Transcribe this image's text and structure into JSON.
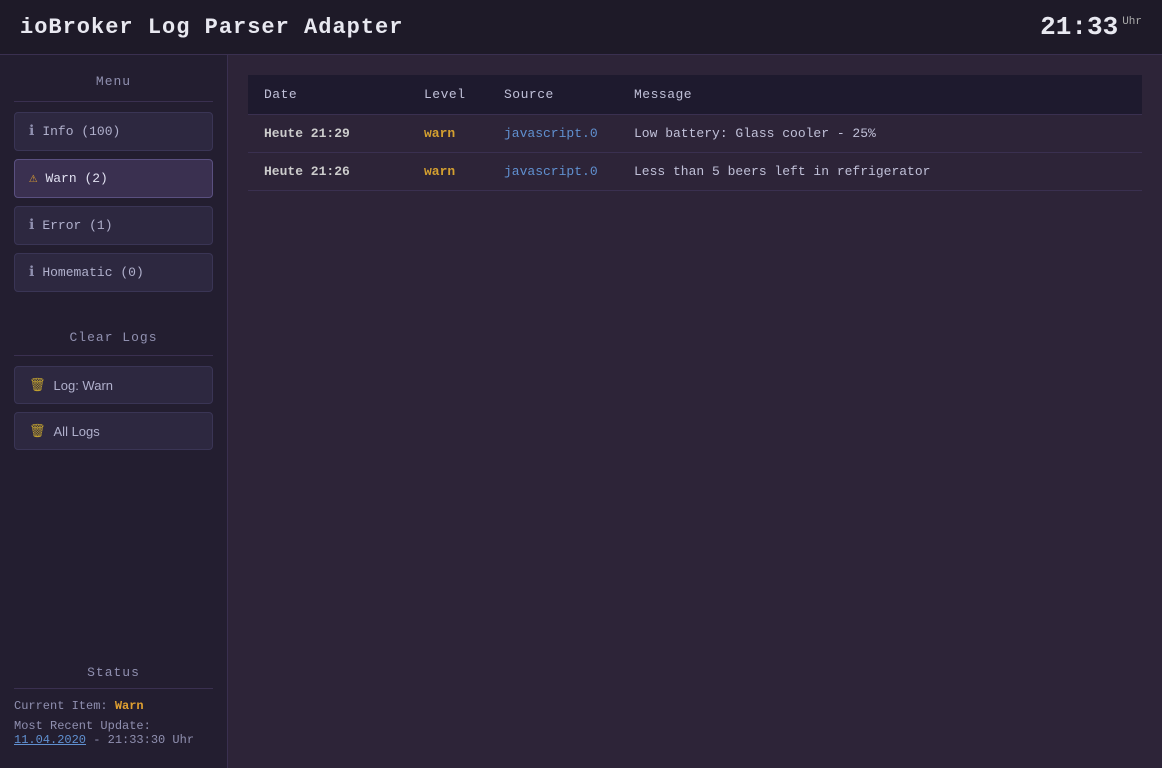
{
  "header": {
    "title": "ioBroker Log Parser Adapter",
    "time": "21:33",
    "time_unit": "Uhr"
  },
  "sidebar": {
    "menu_title": "Menu",
    "items": [
      {
        "id": "info",
        "icon": "ℹ",
        "icon_type": "info",
        "label": "Info (100)",
        "active": false
      },
      {
        "id": "warn",
        "icon": "⚠",
        "icon_type": "warn",
        "label": "Warn (2)",
        "active": true
      },
      {
        "id": "error",
        "icon": "ℹ",
        "icon_type": "info",
        "label": "Error (1)",
        "active": false
      },
      {
        "id": "homematic",
        "icon": "ℹ",
        "icon_type": "info",
        "label": "Homematic (0)",
        "active": false
      }
    ],
    "clear_logs_title": "Clear Logs",
    "clear_buttons": [
      {
        "id": "log-warn",
        "label": "Log: Warn"
      },
      {
        "id": "all-logs",
        "label": "All Logs"
      }
    ],
    "status_title": "Status",
    "status": {
      "current_item_label": "Current Item:",
      "current_item_value": "Warn",
      "most_recent_label": "Most Recent Update:",
      "most_recent_date": "11.04.2020",
      "most_recent_time": " - 21:33:30 Uhr"
    }
  },
  "log_table": {
    "columns": [
      "Date",
      "Level",
      "Source",
      "Message"
    ],
    "rows": [
      {
        "date": "Heute 21:29",
        "level": "warn",
        "source": "javascript.0",
        "message": "Low battery: Glass cooler - 25%"
      },
      {
        "date": "Heute 21:26",
        "level": "warn",
        "source": "javascript.0",
        "message": "Less than 5 beers left in refrigerator"
      }
    ]
  }
}
